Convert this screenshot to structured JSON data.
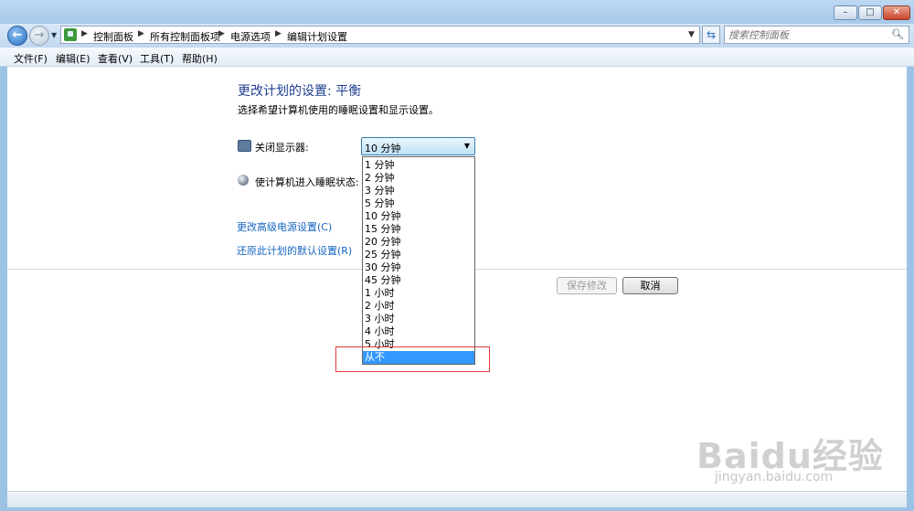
{
  "window": {
    "controls": {
      "minimize": "–",
      "maximize": "□",
      "close": "✕"
    }
  },
  "nav": {
    "back_icon": "arrow-left-icon",
    "back_symbol": "←",
    "forward_symbol": "→",
    "breadcrumbs": [
      "控制面板",
      "所有控制面板项",
      "电源选项",
      "编辑计划设置"
    ],
    "search_placeholder": "搜索控制面板"
  },
  "menu": {
    "items": [
      "文件(F)",
      "编辑(E)",
      "查看(V)",
      "工具(T)",
      "帮助(H)"
    ]
  },
  "page": {
    "title": "更改计划的设置: 平衡",
    "subtitle": "选择希望计算机使用的睡眠设置和显示设置。",
    "display_label": "关闭显示器:",
    "sleep_label": "使计算机进入睡眠状态:",
    "display_value": "10 分钟",
    "dropdown_options": [
      "1 分钟",
      "2 分钟",
      "3 分钟",
      "5 分钟",
      "10 分钟",
      "15 分钟",
      "20 分钟",
      "25 分钟",
      "30 分钟",
      "45 分钟",
      "1 小时",
      "2 小时",
      "3 小时",
      "4 小时",
      "5 小时",
      "从不"
    ],
    "highlighted_option": "从不",
    "link_advanced": "更改高级电源设置(C)",
    "link_restore": "还原此计划的默认设置(R)",
    "save_button": "保存修改",
    "cancel_button": "取消"
  },
  "watermark": {
    "logo": "Baidu经验",
    "url": "jingyan.baidu.com"
  },
  "colors": {
    "title": "#1e3f8f",
    "link": "#1565c0",
    "selection": "#3399ff",
    "highlight_box": "#e03a3a"
  }
}
